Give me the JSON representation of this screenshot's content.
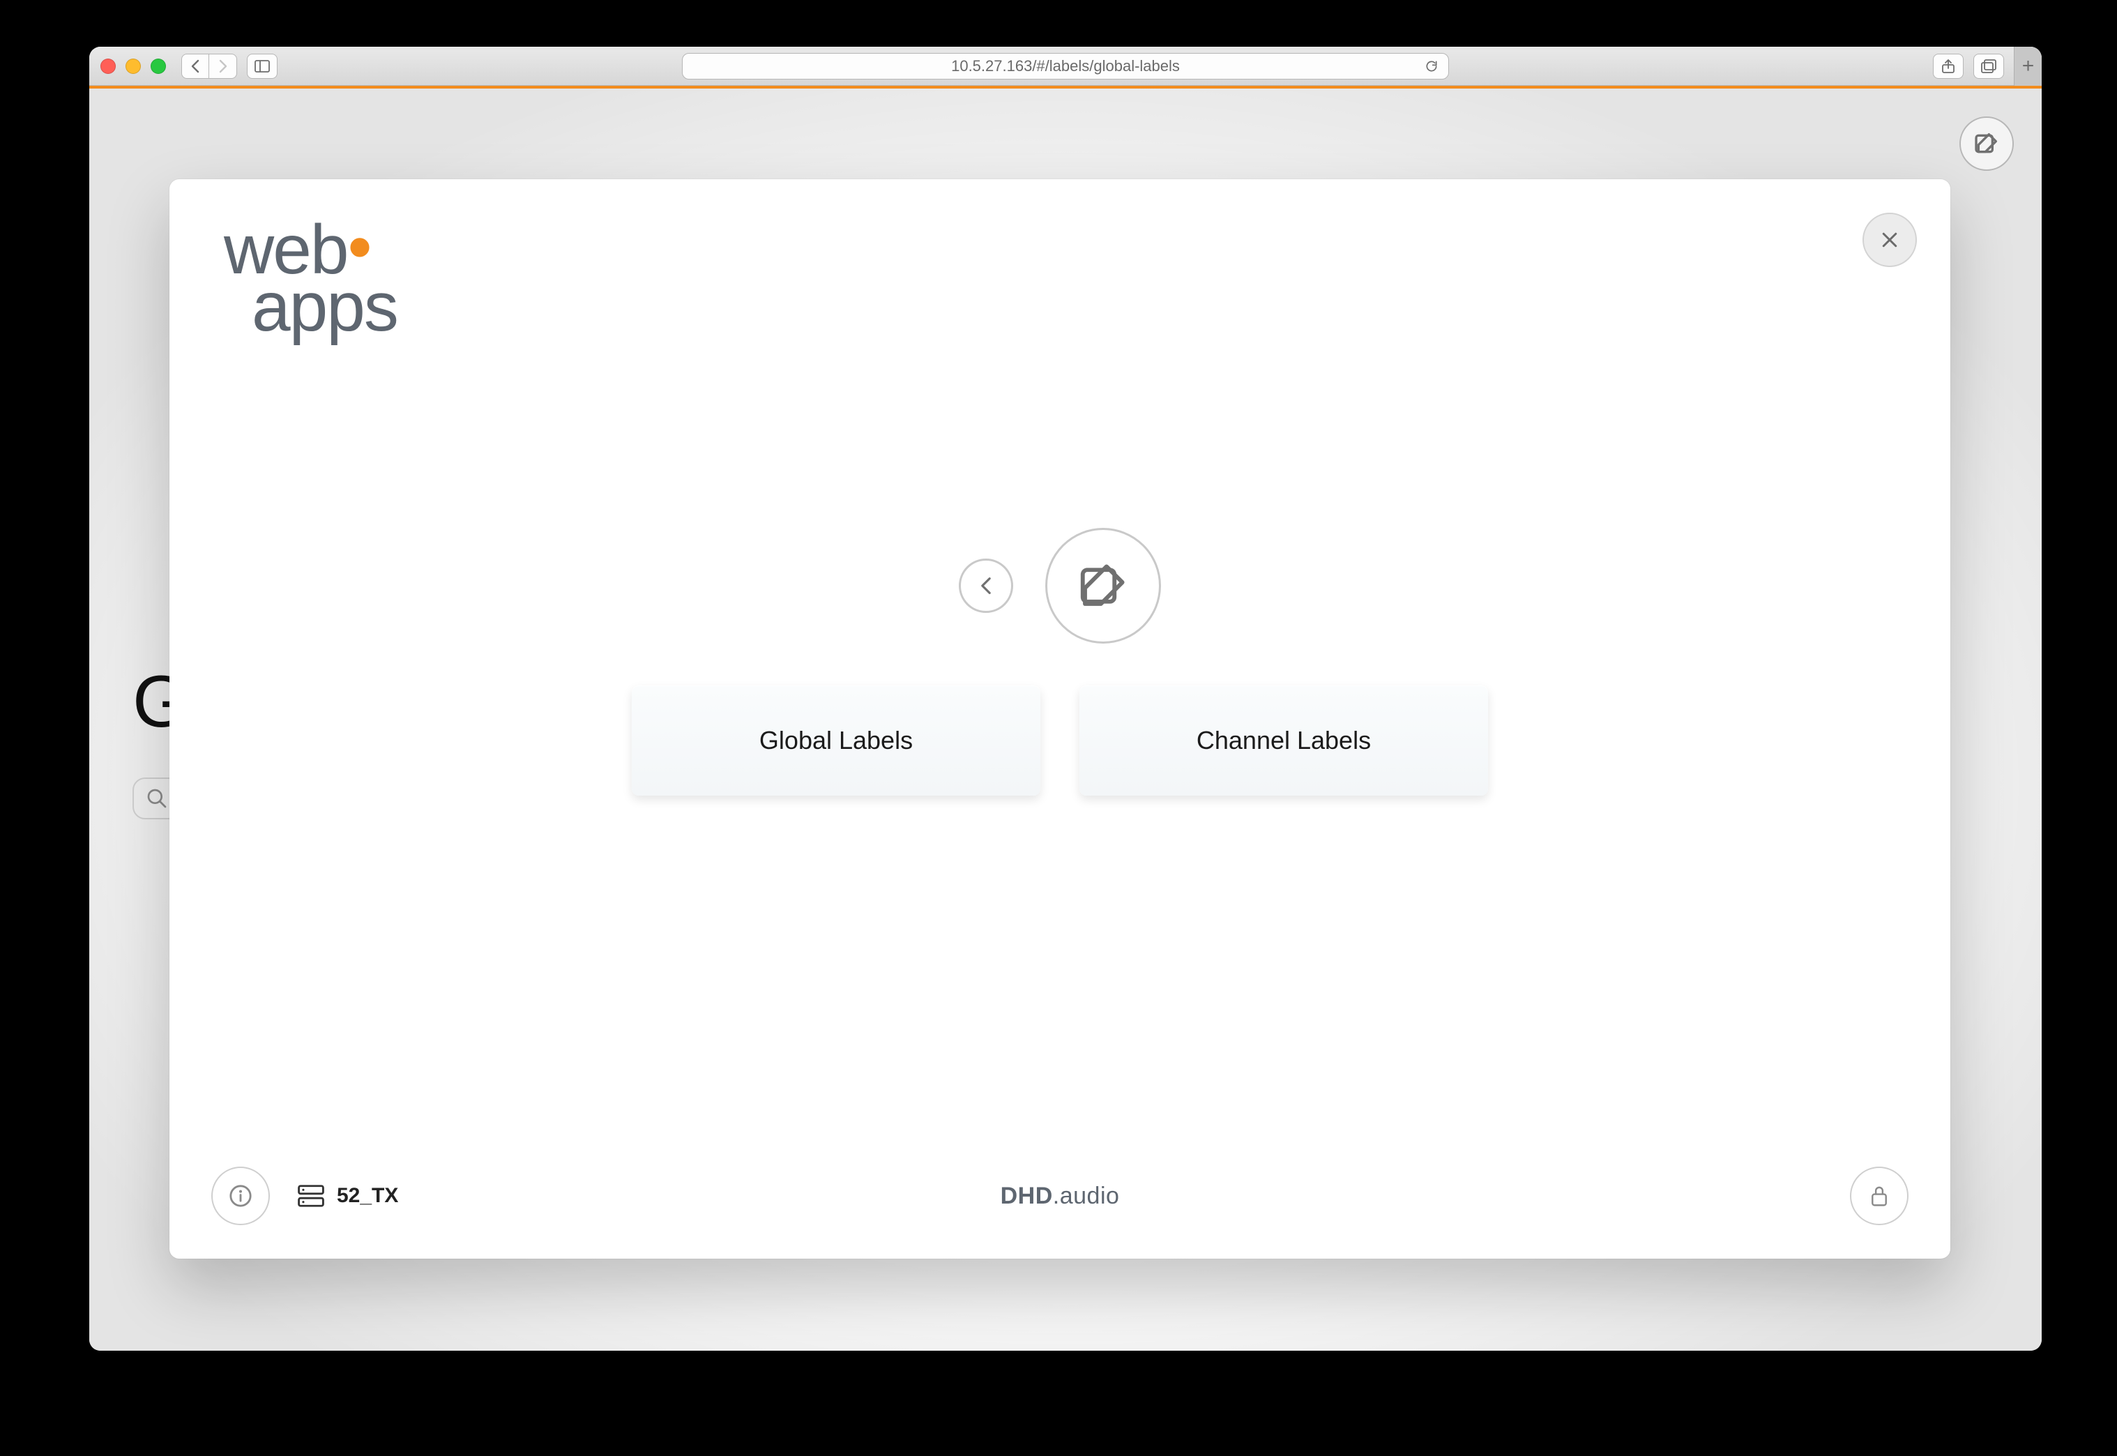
{
  "browser": {
    "url": "10.5.27.163/#/labels/global-labels"
  },
  "background": {
    "heading_first_char": "G"
  },
  "logo": {
    "line1": "web",
    "line2": "apps"
  },
  "nav": {
    "cards": [
      {
        "label": "Global Labels"
      },
      {
        "label": "Channel Labels"
      }
    ]
  },
  "footer": {
    "device_label": "52_TX",
    "brand_bold": "DHD",
    "brand_rest": ".audio"
  }
}
